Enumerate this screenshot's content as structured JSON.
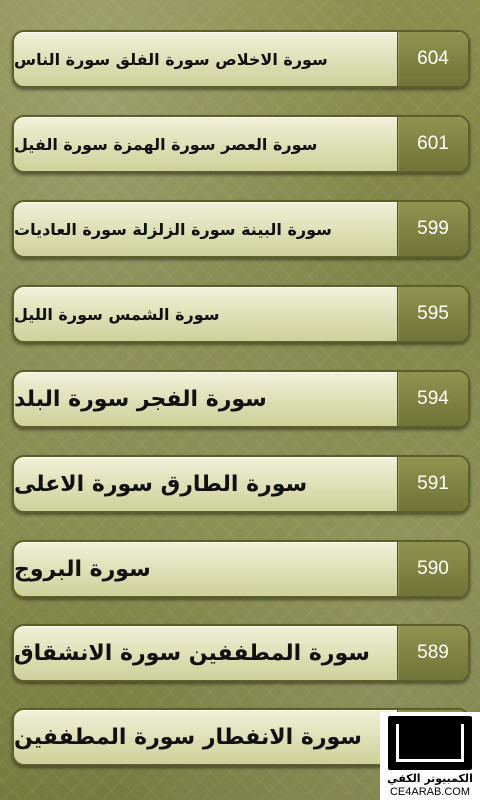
{
  "surah_list": [
    {
      "page": "604",
      "title": "سورة الاخلاص سورة الفلق سورة الناس",
      "size": "small"
    },
    {
      "page": "601",
      "title": "سورة العصر سورة الهمزة سورة الفيل",
      "size": "small"
    },
    {
      "page": "599",
      "title": "سورة البينة سورة الزلزلة سورة العاديات",
      "size": "small"
    },
    {
      "page": "595",
      "title": "سورة الشمس سورة الليل",
      "size": "small"
    },
    {
      "page": "594",
      "title": "سورة الفجر سورة البلد",
      "size": "large"
    },
    {
      "page": "591",
      "title": "سورة الطارق سورة الاعلى",
      "size": "large"
    },
    {
      "page": "590",
      "title": "سورة البروج",
      "size": "large"
    },
    {
      "page": "589",
      "title": "سورة المطففين سورة الانشقاق",
      "size": "large"
    },
    {
      "page": "",
      "title": "سورة الانفطار سورة المطففين",
      "size": "large"
    }
  ],
  "watermark": {
    "arabic_text": "الكمبيوتر الكفي",
    "site_text": "CE4ARAB.COM"
  }
}
